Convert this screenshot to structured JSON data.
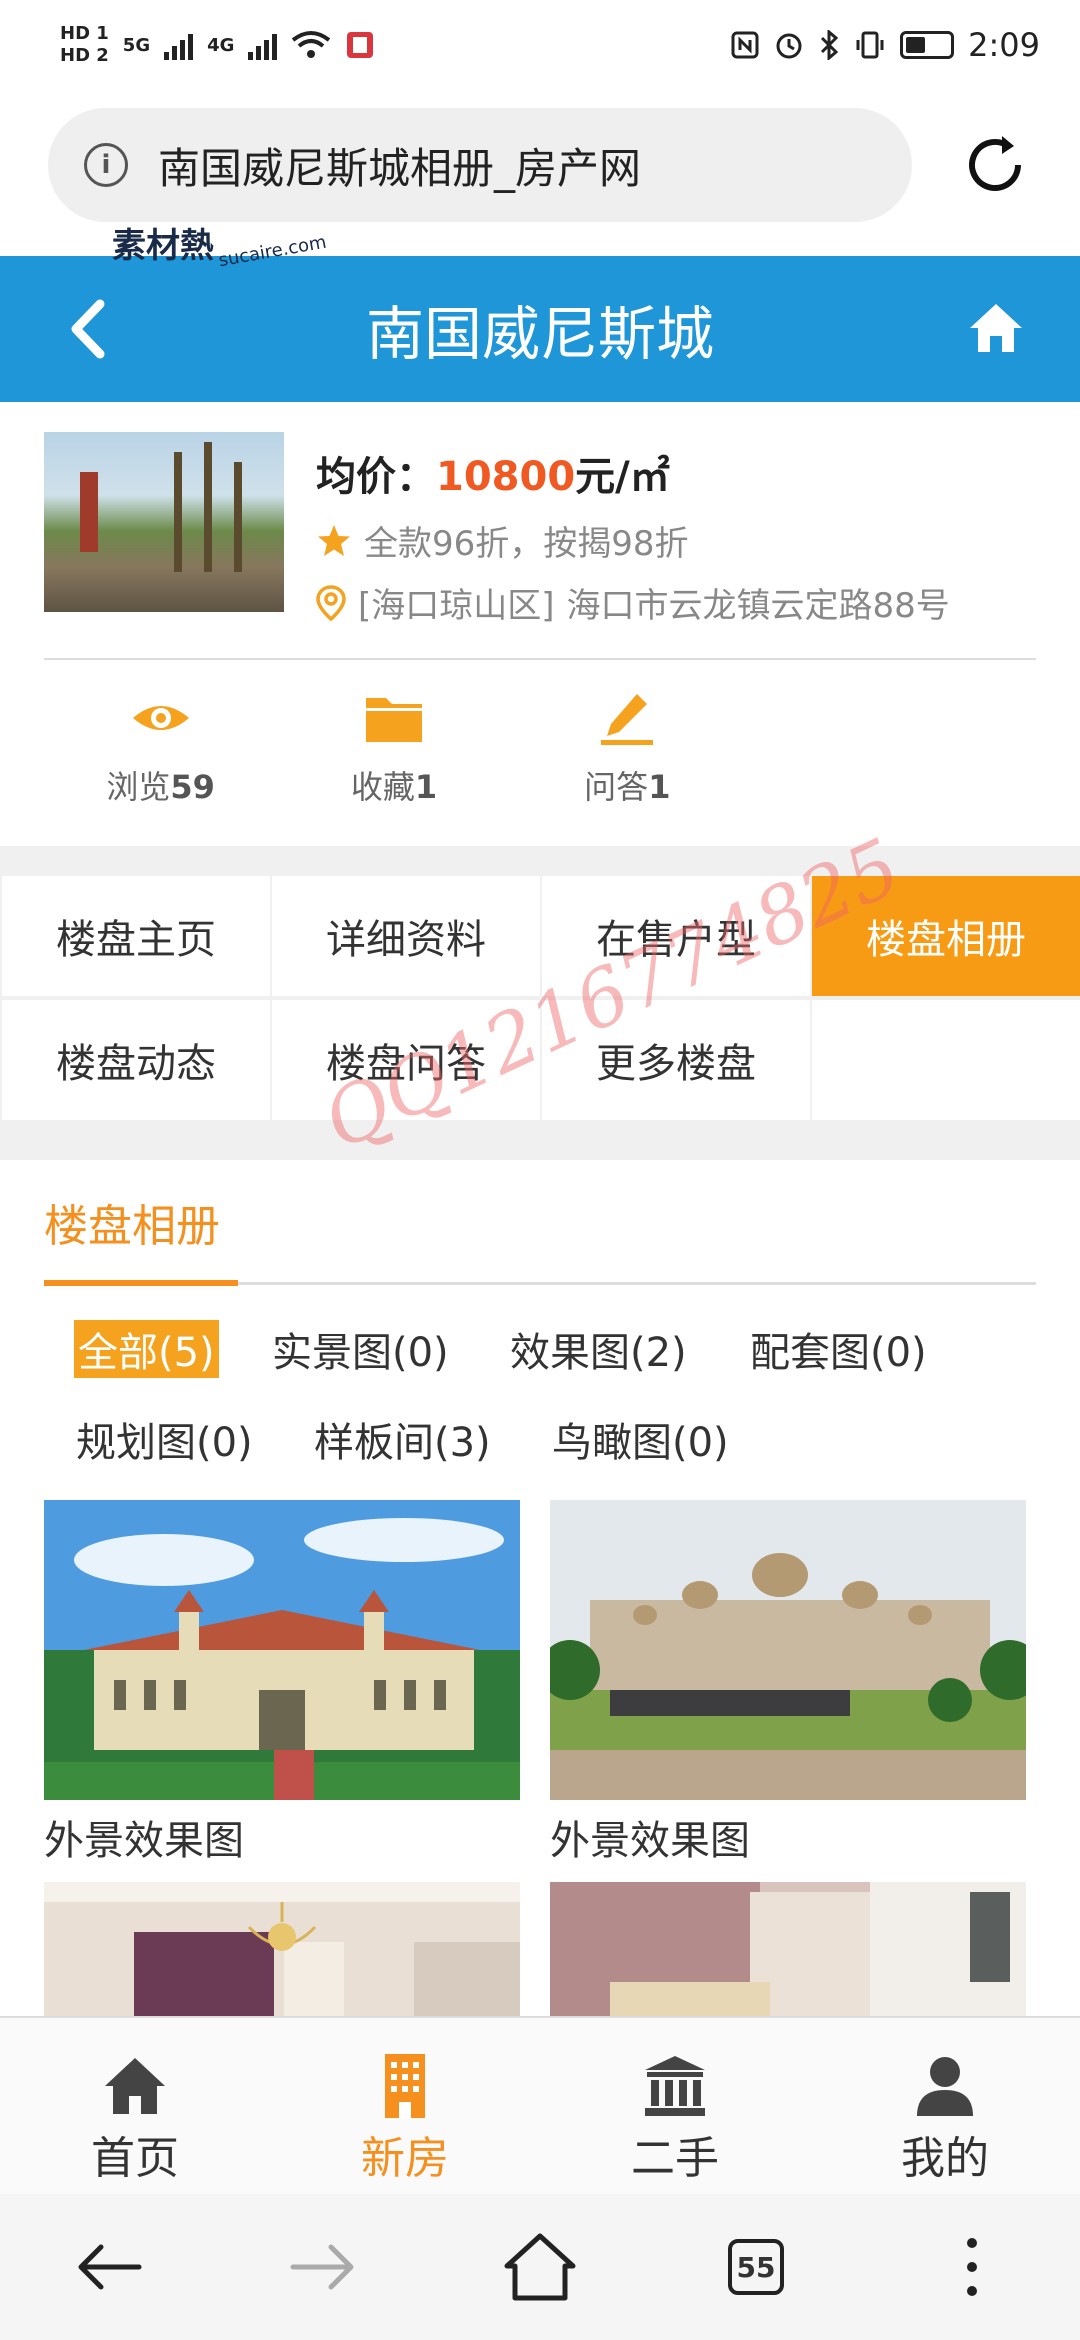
{
  "status_bar": {
    "time": "2:09",
    "sim1": "HD 1",
    "sim2": "HD 2",
    "net1": "5G",
    "net2": "4G"
  },
  "browser": {
    "url_title": "南国威尼斯城相册_房产网",
    "tab_count": "55"
  },
  "watermark": {
    "logo": "素材熱",
    "logo_url": "sucaire.com",
    "overlay": "QQ1216774825"
  },
  "header": {
    "title": "南国威尼斯城"
  },
  "summary": {
    "price_label": "均价：",
    "price_value": "10800",
    "price_unit": "元/㎡",
    "discount": "全款96折，按揭98折",
    "district": "[海口琼山区]",
    "address": "海口市云龙镇云定路88号"
  },
  "stats": [
    {
      "label": "浏览",
      "count": "59"
    },
    {
      "label": "收藏",
      "count": "1"
    },
    {
      "label": "问答",
      "count": "1"
    }
  ],
  "nav_grid": [
    {
      "label": "楼盘主页",
      "active": false
    },
    {
      "label": "详细资料",
      "active": false
    },
    {
      "label": "在售户型",
      "active": false
    },
    {
      "label": "楼盘相册",
      "active": true
    },
    {
      "label": "楼盘动态",
      "active": false
    },
    {
      "label": "楼盘问答",
      "active": false
    },
    {
      "label": "更多楼盘",
      "active": false
    }
  ],
  "album": {
    "title": "楼盘相册",
    "filters": [
      "全部(5)",
      "实景图(0)",
      "效果图(2)",
      "配套图(0)",
      "规划图(0)",
      "样板间(3)",
      "鸟瞰图(0)"
    ],
    "photos": [
      {
        "caption": "外景效果图"
      },
      {
        "caption": "外景效果图"
      },
      {
        "caption": ""
      },
      {
        "caption": ""
      }
    ]
  },
  "tabbar": [
    {
      "label": "首页",
      "icon": "home-icon",
      "active": false
    },
    {
      "label": "新房",
      "icon": "building-icon",
      "active": true
    },
    {
      "label": "二手",
      "icon": "bank-icon",
      "active": false
    },
    {
      "label": "我的",
      "icon": "user-icon",
      "active": false
    }
  ],
  "colors": {
    "header_blue": "#1e96d7",
    "accent_orange": "#f89b14",
    "price_red": "#f05a22"
  }
}
